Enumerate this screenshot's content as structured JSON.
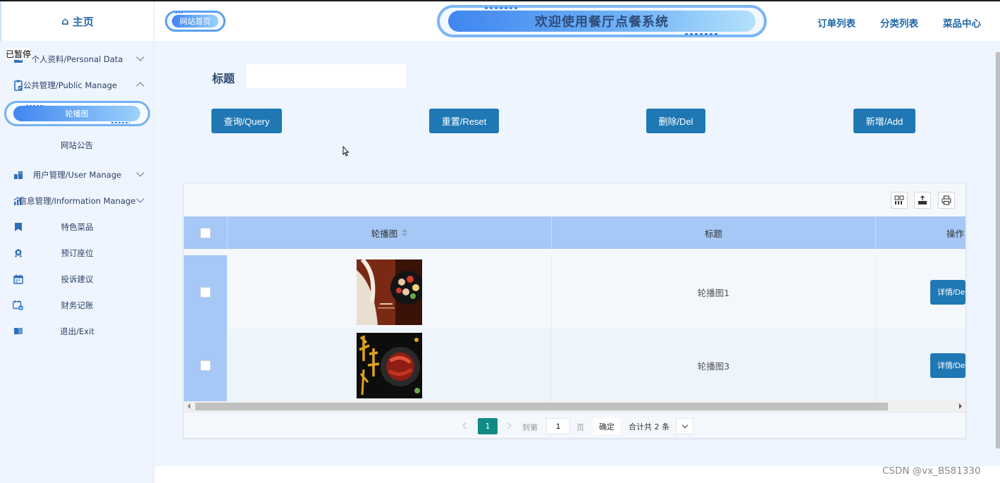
{
  "overlay": {
    "paused": "已暂停"
  },
  "sidebar": {
    "home": "主页",
    "items": [
      {
        "label": "个人资料/Personal Data",
        "icon": "user-card-icon",
        "expanded": false
      },
      {
        "label": "公共管理/Public Manage",
        "icon": "clipboard-icon",
        "expanded": true
      },
      {
        "label": "用户管理/User Manage",
        "icon": "building-icon",
        "expanded": false
      },
      {
        "label": "信息管理/Information Manage",
        "icon": "chart-icon",
        "expanded": false
      },
      {
        "label": "特色菜品",
        "icon": "bookmark-icon"
      },
      {
        "label": "预订座位",
        "icon": "badge-icon"
      },
      {
        "label": "投诉建议",
        "icon": "calendar-icon"
      },
      {
        "label": "财务记账",
        "icon": "calendar-check-icon"
      },
      {
        "label": "退出/Exit",
        "icon": "book-icon"
      }
    ],
    "sub_items": [
      {
        "label": "轮播图",
        "active": true
      },
      {
        "label": "网站公告",
        "active": false
      }
    ]
  },
  "header": {
    "home_label": "网站首页",
    "title": "欢迎使用餐厅点餐系统",
    "nav": [
      "订单列表",
      "分类列表",
      "菜品中心"
    ]
  },
  "search": {
    "label": "标题",
    "value": ""
  },
  "buttons": {
    "query": "查询/Query",
    "reset": "重置/Reset",
    "delete": "删除/Del",
    "add": "新增/Add"
  },
  "toolbar_icons": [
    "columns-icon",
    "export-icon",
    "print-icon"
  ],
  "table": {
    "columns": [
      "轮播图",
      "标题",
      "操作"
    ],
    "rows": [
      {
        "title": "轮播图1",
        "action": "详情/Detail"
      },
      {
        "title": "轮播图3",
        "action": "详情/Detail"
      }
    ]
  },
  "pagination": {
    "current_page": "1",
    "goto_label": "到第",
    "goto_value": "1",
    "page_unit": "页",
    "confirm": "确定",
    "total": "合计共 2 条"
  },
  "watermark": "CSDN @vx_BS81330",
  "colors": {
    "accent": "#1f78b4",
    "header_row": "#a5c8f6",
    "page_active": "#0f8a85"
  }
}
